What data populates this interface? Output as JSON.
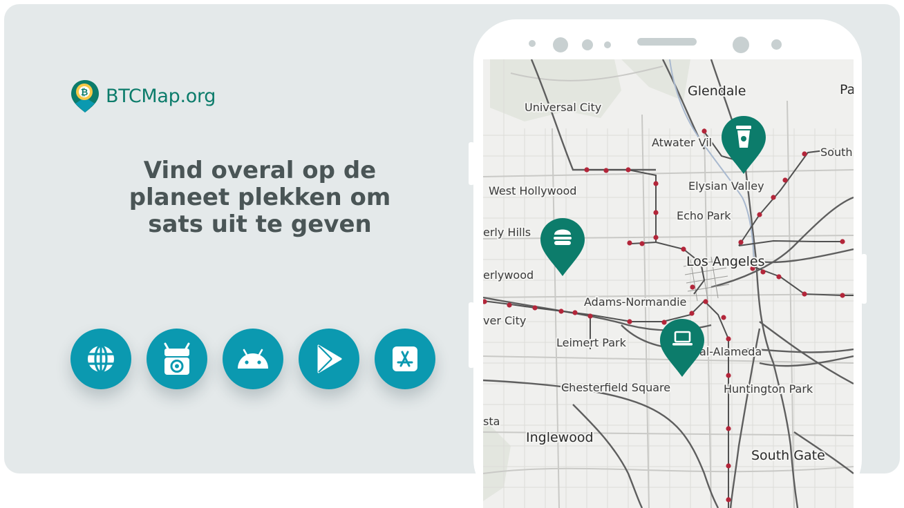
{
  "brand": {
    "name": "BTCMap.org",
    "logo_icon": "bitcoin-map-pin-icon",
    "color": "#0c7c6b"
  },
  "headline": {
    "line1": "Vind overal op de",
    "line2": "planeet plekken om",
    "line3": "sats uit te geven"
  },
  "download_buttons": [
    {
      "icon": "globe-icon"
    },
    {
      "icon": "f-droid-icon"
    },
    {
      "icon": "android-icon"
    },
    {
      "icon": "google-play-icon"
    },
    {
      "icon": "app-store-icon"
    }
  ],
  "colors": {
    "background": "#e4e9ea",
    "headline": "#4a5556",
    "button": "#0b99b0",
    "marker": "#0c7c6b",
    "rail": "#b3263a"
  },
  "map": {
    "labels": {
      "glendale": "Glendale",
      "pa": "Pa",
      "universal_city": "Universal City",
      "atwater": "Atwater Vil",
      "south": "South",
      "west_hollywood": "West Hollywood",
      "elysian_valley": "Elysian Valley",
      "echo_park": "Echo Park",
      "beverly_hills": "erly Hills",
      "los_angeles": "Los Angeles",
      "beverlywood": "erlywood",
      "adams_normandie": "Adams-Normandie",
      "culver_city": "ver City",
      "leimert_park": "Leimert Park",
      "alameda": "al-Alameda",
      "chesterfield_square": "Chesterfield Square",
      "huntington_park": "Huntington Park",
      "sta": "sta",
      "inglewood": "Inglewood",
      "south_gate": "South Gate"
    },
    "markers": [
      {
        "category": "coffee-cup-icon"
      },
      {
        "category": "burger-icon"
      },
      {
        "category": "laptop-icon"
      }
    ]
  }
}
